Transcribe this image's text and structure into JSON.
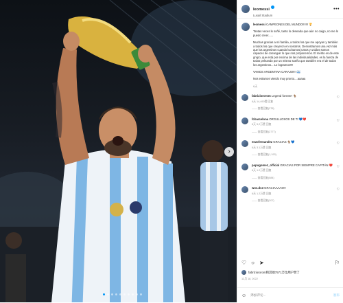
{
  "post": {
    "username": "leomessi",
    "location": "Lusail Stadium",
    "more_icon": "more-icon",
    "caption_lines": [
      "CAMPEONES DEL MUNDO!!!!!!! 🏆",
      "Tantas veces lo soñé, tanto lo deseaba que aún no caigo, no me lo puedo creer......",
      "Muchas gracias a mi familia, a todos los que me apoyan y también a todos los que creyeron en nosotros. Demostramos una vez más que los argentinos cuando luchamos juntos y unidos somos capaces de conseguir lo que nos proponemos. El mérito es de este grupo, que está por encima de las individualidades, es la fuerza de todos peleando por un mismo sueño que también era el de todos los argentinos... Lo logramos!!!!",
      "VAMOS ARGENTINA CARAJO!!!! 🇦🇷",
      "Nos estamos viendo muy pronto....aaaaa"
    ],
    "caption_time": "6天",
    "comments": [
      {
        "user": "fabriziororom",
        "text": "Legend forever! 🐐",
        "meta": "6天  14,490赞  回复",
        "replies": "—— 查看回复(278)"
      },
      {
        "user": "fcbarcelona",
        "text": "ORGULLOSOS DE TI 💙❤️",
        "meta": "6天  5,2万赞  回复",
        "replies": "—— 查看回复(2777)"
      },
      {
        "user": "enzofernandez",
        "text": "GRACIAS 🐐💙",
        "meta": "6天  3.1万赞  回复",
        "replies": "—— 查看回复(1,193)"
      },
      {
        "user": "papugomez_official",
        "text": "GRACIAS POR SIEMPRE CAPITÁN ❤️",
        "meta": "6天  1.2万赞  回复",
        "replies": "—— 查看回复(584)"
      },
      {
        "user": "wos.ds3",
        "text": "GRACIAAAAS!!!",
        "meta": "6天  1.2万赞  回复",
        "replies": "—— 查看回复(207)"
      }
    ],
    "likes_text": "fabriziororom和其他7571万位用户赞了",
    "date": "12月 18, 2022",
    "add_comment_placeholder": "添加评论...",
    "post_button": "发布"
  },
  "colors": {
    "accent": "#0095f6",
    "text": "#262626",
    "muted": "#8e8e8e"
  }
}
